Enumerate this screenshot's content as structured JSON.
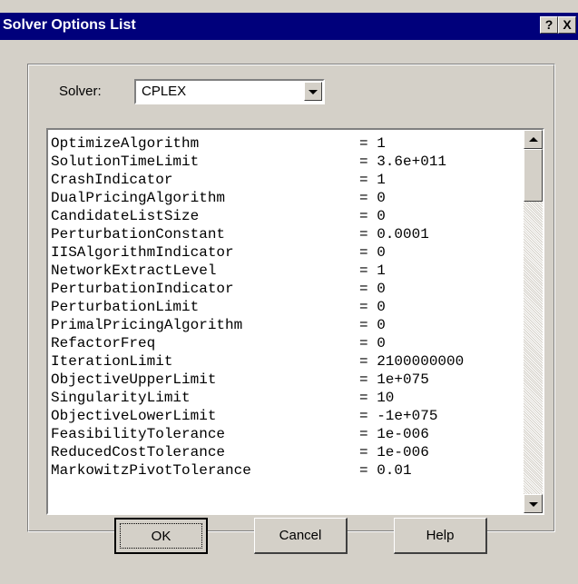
{
  "window": {
    "title": "Solver Options List",
    "help_button": "?",
    "close_button": "X"
  },
  "solver": {
    "label": "Solver:",
    "selected": "CPLEX"
  },
  "options": [
    {
      "name": "OptimizeAlgorithm",
      "value": "= 1"
    },
    {
      "name": "SolutionTimeLimit",
      "value": "= 3.6e+011"
    },
    {
      "name": "CrashIndicator",
      "value": "= 1"
    },
    {
      "name": "DualPricingAlgorithm",
      "value": "= 0"
    },
    {
      "name": "CandidateListSize",
      "value": "= 0"
    },
    {
      "name": "PerturbationConstant",
      "value": "= 0.0001"
    },
    {
      "name": "IISAlgorithmIndicator",
      "value": "= 0"
    },
    {
      "name": "NetworkExtractLevel",
      "value": "= 1"
    },
    {
      "name": "PerturbationIndicator",
      "value": "= 0"
    },
    {
      "name": "PerturbationLimit",
      "value": "= 0"
    },
    {
      "name": "PrimalPricingAlgorithm",
      "value": "= 0"
    },
    {
      "name": "RefactorFreq",
      "value": "= 0"
    },
    {
      "name": "IterationLimit",
      "value": "= 2100000000"
    },
    {
      "name": "ObjectiveUpperLimit",
      "value": "= 1e+075"
    },
    {
      "name": "SingularityLimit",
      "value": "= 10"
    },
    {
      "name": "ObjectiveLowerLimit",
      "value": "= -1e+075"
    },
    {
      "name": "FeasibilityTolerance",
      "value": "= 1e-006"
    },
    {
      "name": "ReducedCostTolerance",
      "value": "= 1e-006"
    },
    {
      "name": "MarkowitzPivotTolerance",
      "value": "= 0.01"
    }
  ],
  "buttons": {
    "ok": "OK",
    "cancel": "Cancel",
    "help": "Help"
  }
}
